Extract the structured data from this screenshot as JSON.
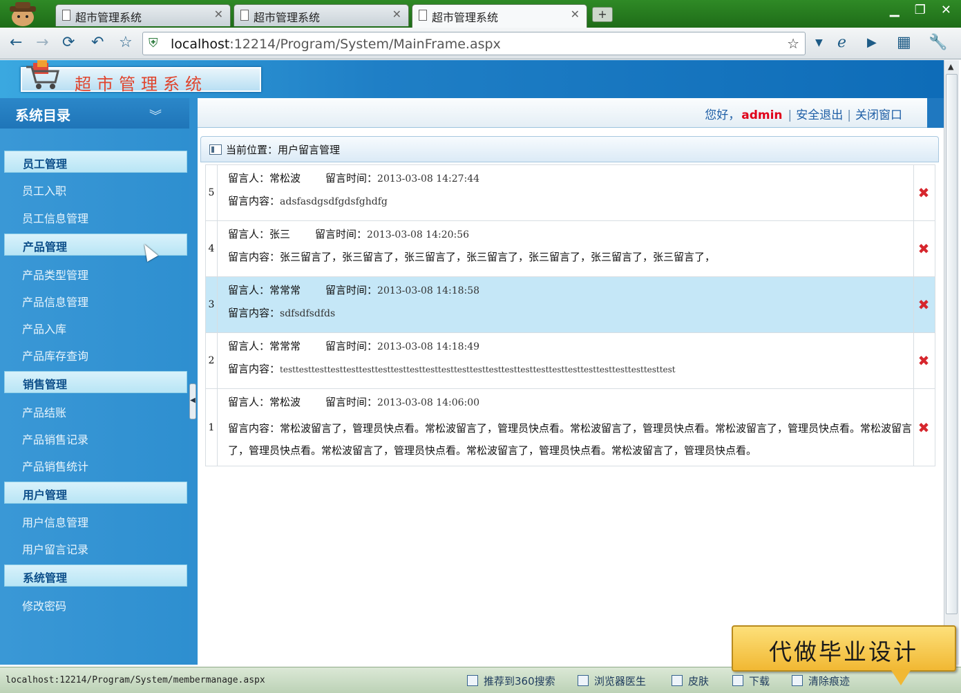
{
  "browser": {
    "tabs": [
      {
        "title": "超市管理系统",
        "active": false
      },
      {
        "title": "超市管理系统",
        "active": false
      },
      {
        "title": "超市管理系统",
        "active": true
      }
    ],
    "new_tab": "+",
    "address": {
      "host": "localhost",
      "rest": ":12214/Program/System/MainFrame.aspx"
    }
  },
  "header": {
    "logo_text": "超市管理系统"
  },
  "sidebar": {
    "title": "系统目录",
    "groups": [
      {
        "label": "员工管理",
        "items": [
          "员工入职",
          "员工信息管理"
        ]
      },
      {
        "label": "产品管理",
        "items": [
          "产品类型管理",
          "产品信息管理",
          "产品入库",
          "产品库存查询"
        ]
      },
      {
        "label": "销售管理",
        "items": [
          "产品结账",
          "产品销售记录",
          "产品销售统计"
        ]
      },
      {
        "label": "用户管理",
        "items": [
          "用户信息管理",
          "用户留言记录"
        ]
      },
      {
        "label": "系统管理",
        "items": [
          "修改密码"
        ]
      }
    ]
  },
  "topbar": {
    "greeting": "您好，",
    "username": "admin",
    "logout": "安全退出",
    "close": "关闭窗口"
  },
  "breadcrumb": {
    "text": "当前位置：用户留言管理"
  },
  "labels": {
    "author": "留言人：",
    "time": "留言时间：",
    "content": "留言内容："
  },
  "messages": [
    {
      "num": "5",
      "author": "常松波",
      "time": "2013-03-08 14:27:44",
      "content": "adsfasdgsdfgdsfghdfg",
      "highlight": false
    },
    {
      "num": "4",
      "author": "张三",
      "time": "2013-03-08 14:20:56",
      "content": "张三留言了，张三留言了，张三留言了，张三留言了，张三留言了，张三留言了，张三留言了，",
      "highlight": false
    },
    {
      "num": "3",
      "author": "常常常",
      "time": "2013-03-08 14:18:58",
      "content": "sdfsdfsdfds",
      "highlight": true
    },
    {
      "num": "2",
      "author": "常常常",
      "time": "2013-03-08 14:18:49",
      "content": "testtesttesttesttesttesttesttesttesttesttesttesttesttesttesttesttesttesttesttesttesttesttesttesttest",
      "highlight": false
    },
    {
      "num": "1",
      "author": "常松波",
      "time": "2013-03-08 14:06:00",
      "content": "常松波留言了，管理员快点看。常松波留言了，管理员快点看。常松波留言了，管理员快点看。常松波留言了，管理员快点看。常松波留言了，管理员快点看。常松波留言了，管理员快点看。常松波留言了，管理员快点看。常松波留言了，管理员快点看。",
      "highlight": false
    }
  ],
  "statusbar": {
    "url": "localhost:12214/Program/System/membermanage.aspx",
    "items": [
      "推荐到360搜索",
      "浏览器医生",
      "皮肤",
      "下载",
      "清除痕迹"
    ]
  },
  "ad": {
    "text": "代做毕业设计"
  },
  "colors": {
    "accent": "#1f78c0",
    "username": "#e0001a",
    "delete": "#d6262d",
    "highlight_row": "#c5e7f7"
  }
}
